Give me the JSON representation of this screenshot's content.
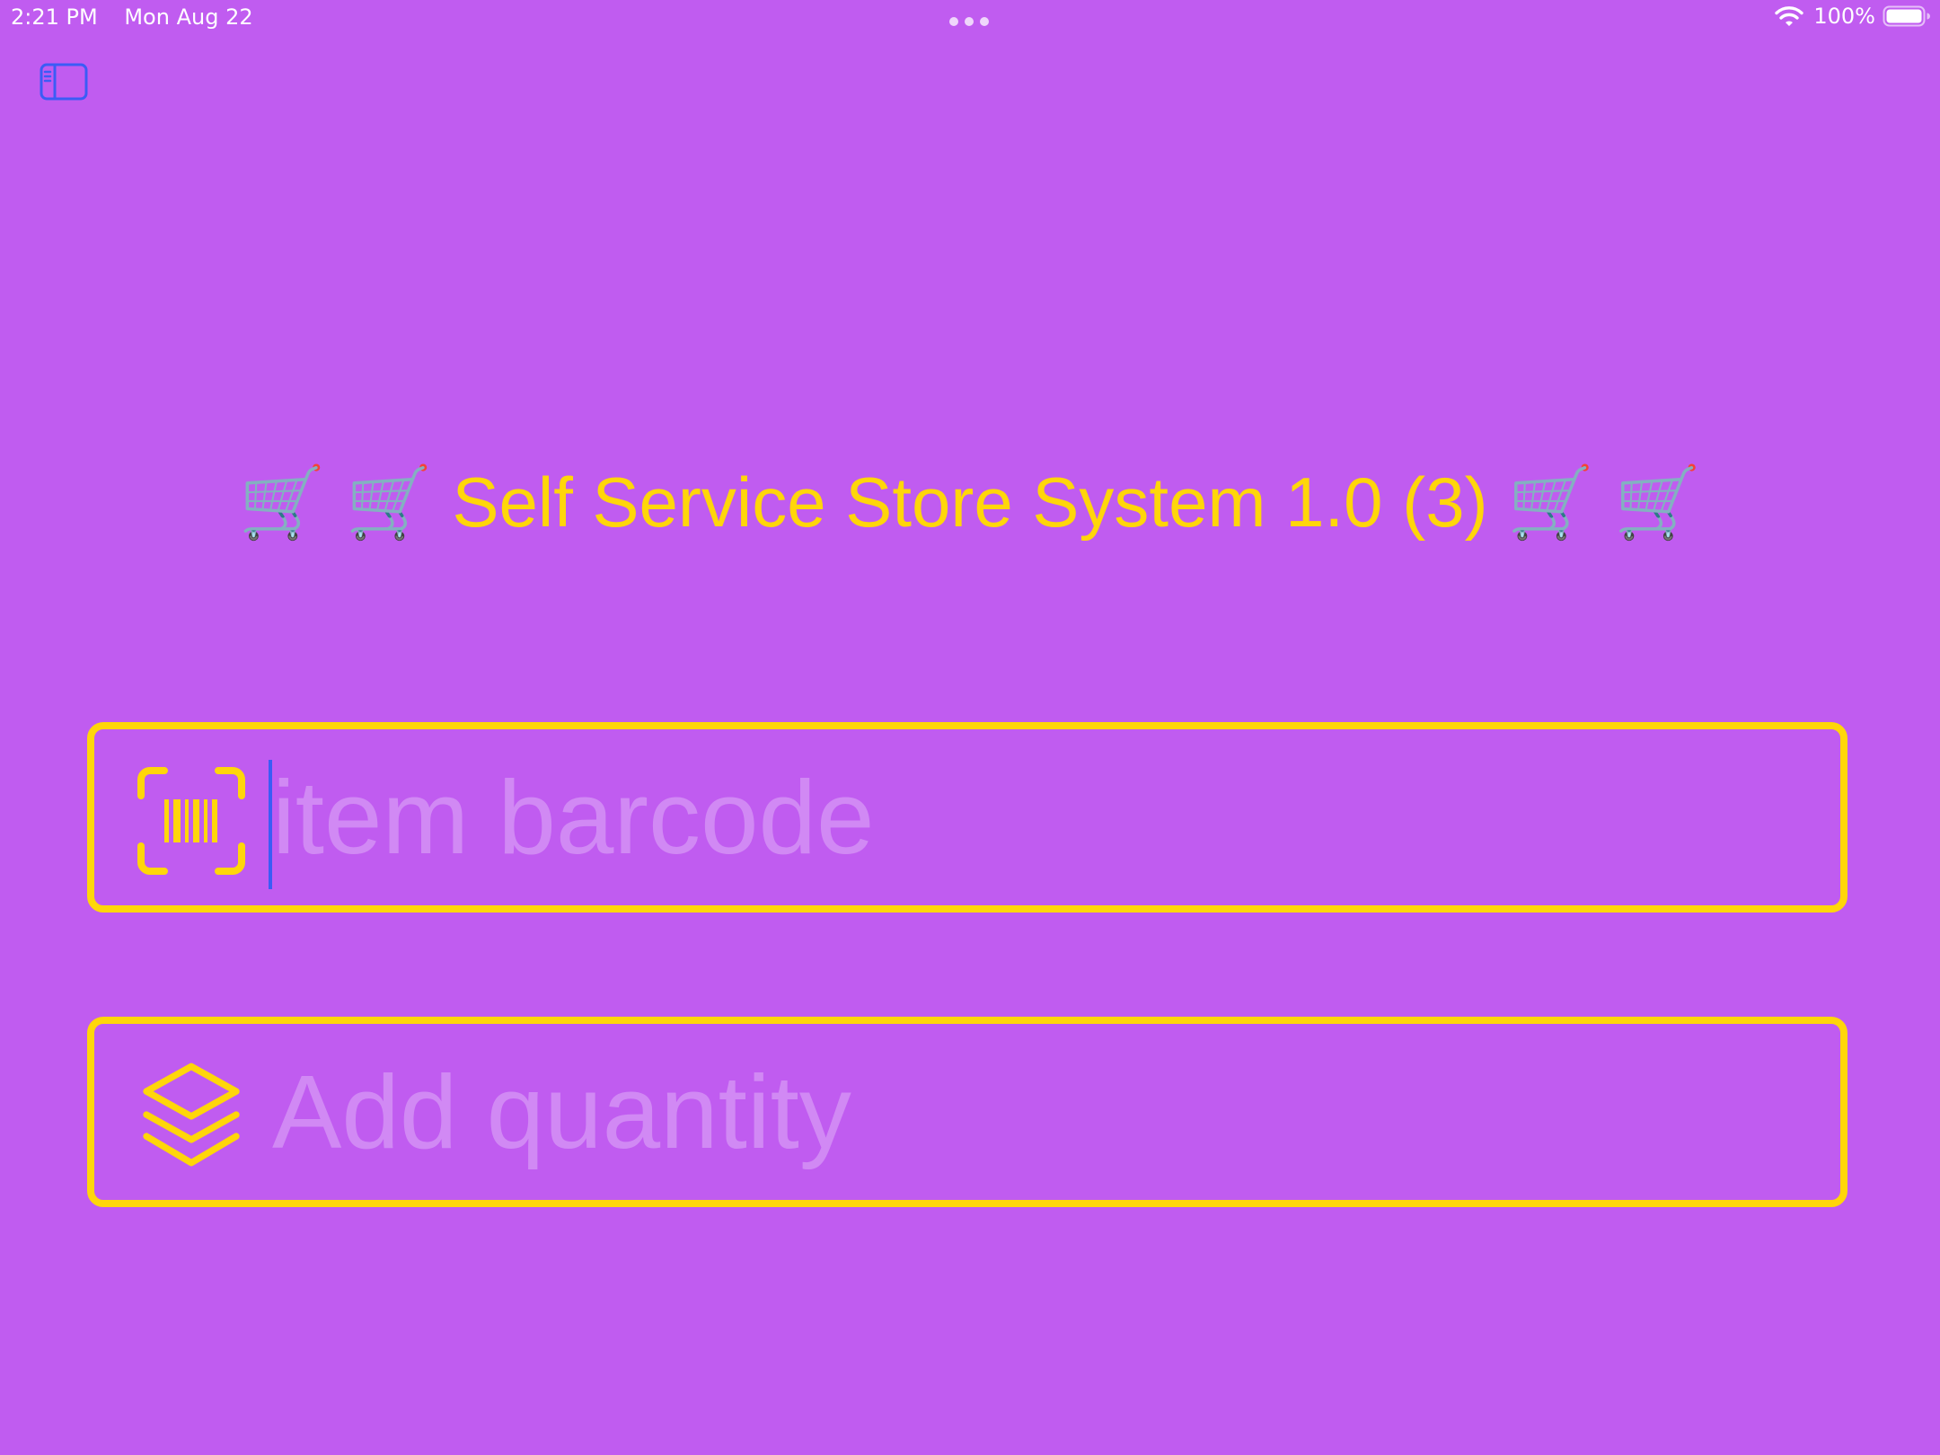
{
  "status_bar": {
    "time": "2:21 PM",
    "date": "Mon Aug 22",
    "battery": "100%",
    "icons": [
      "wifi-icon",
      "battery-icon",
      "multitasking-dots-icon"
    ]
  },
  "toolbar": {
    "sidebar_icon": "sidebar-toggle-icon"
  },
  "header": {
    "title": "Self Service Store System 1.0 (3)",
    "decoration_left": "🛒 🛒",
    "decoration_right": "🛒 🛒"
  },
  "form": {
    "barcode": {
      "placeholder": "item barcode",
      "value": "",
      "icon": "barcode-viewfinder-icon"
    },
    "quantity": {
      "placeholder": "Add quantity",
      "value": "",
      "icon": "layers-stack-icon"
    }
  },
  "colors": {
    "background": "#c05cf0",
    "accent": "#ffd60a",
    "system_blue": "#3b5cf6"
  }
}
